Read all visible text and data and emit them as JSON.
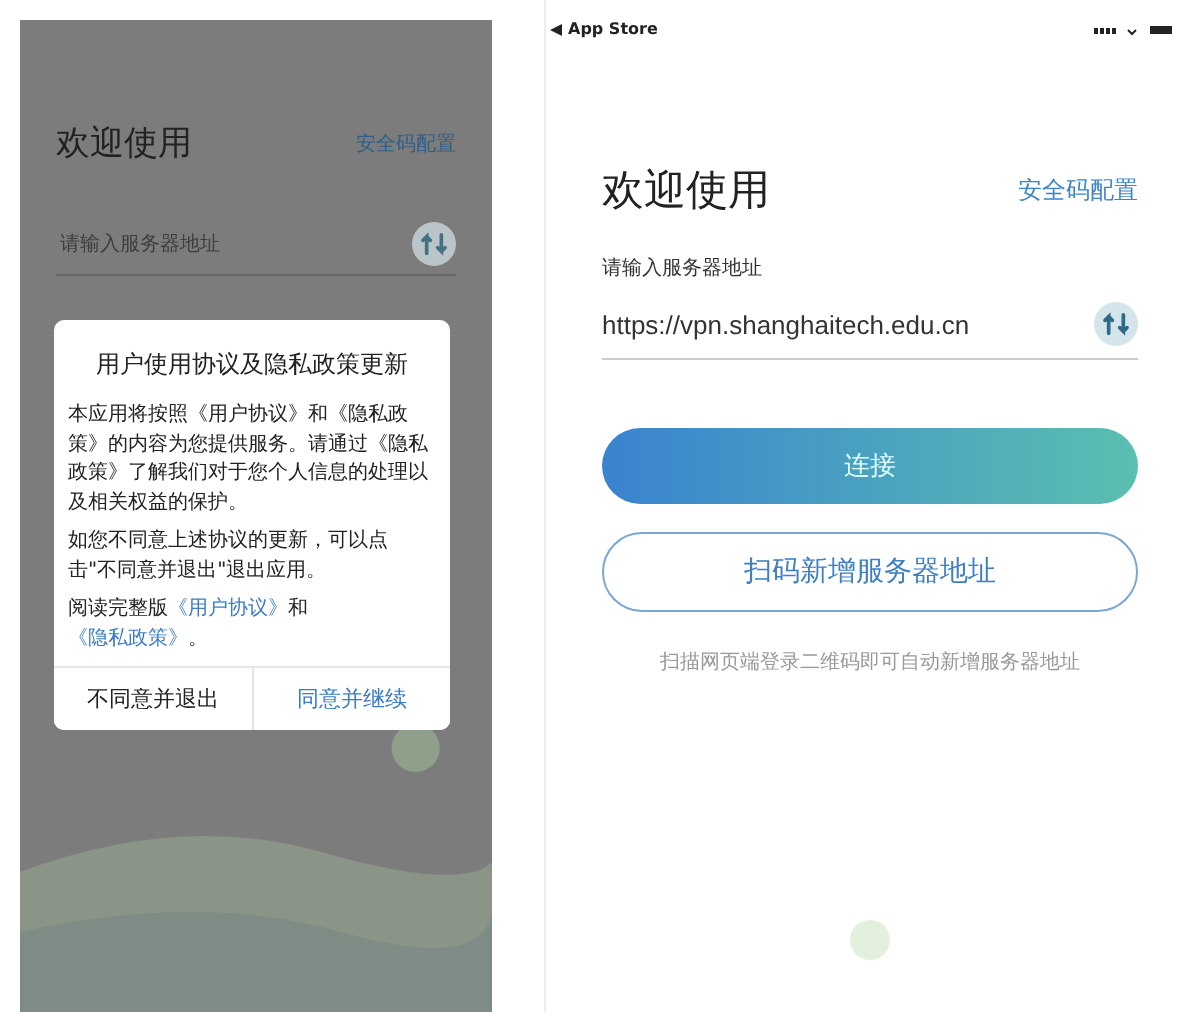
{
  "left_screen": {
    "title": "欢迎使用",
    "security_link": "安全码配置",
    "server_field": {
      "placeholder": "请输入服务器地址"
    },
    "dialog": {
      "title": "用户使用协议及隐私政策更新",
      "paragraphs": [
        "本应用将按照《用户协议》和《隐私政策》的内容为您提供服务。请通过《隐私政策》了解我们对于您个人信息的处理以及相关权益的保护。",
        "如您不同意上述协议的更新，可以点击\"不同意并退出\"退出应用。"
      ],
      "read_full": {
        "prefix": "阅读完整版",
        "links": [
          "《用户协议》",
          "《隐私政策》"
        ],
        "joiner": "和",
        "suffix": "。"
      },
      "buttons": [
        {
          "label": "不同意并退出",
          "kind": "secondary"
        },
        {
          "label": "同意并继续",
          "kind": "primary"
        }
      ]
    }
  },
  "right_screen": {
    "status_bar": {
      "back_label": "App Store"
    },
    "title": "欢迎使用",
    "security_link": "安全码配置",
    "server_field": {
      "label": "请输入服务器地址",
      "value": "https://vpn.shanghaitech.edu.cn"
    },
    "connect_button": "连接",
    "scan_button": "扫码新增服务器地址",
    "hint": "扫描网页端登录二维码即可自动新增服务器地址"
  }
}
